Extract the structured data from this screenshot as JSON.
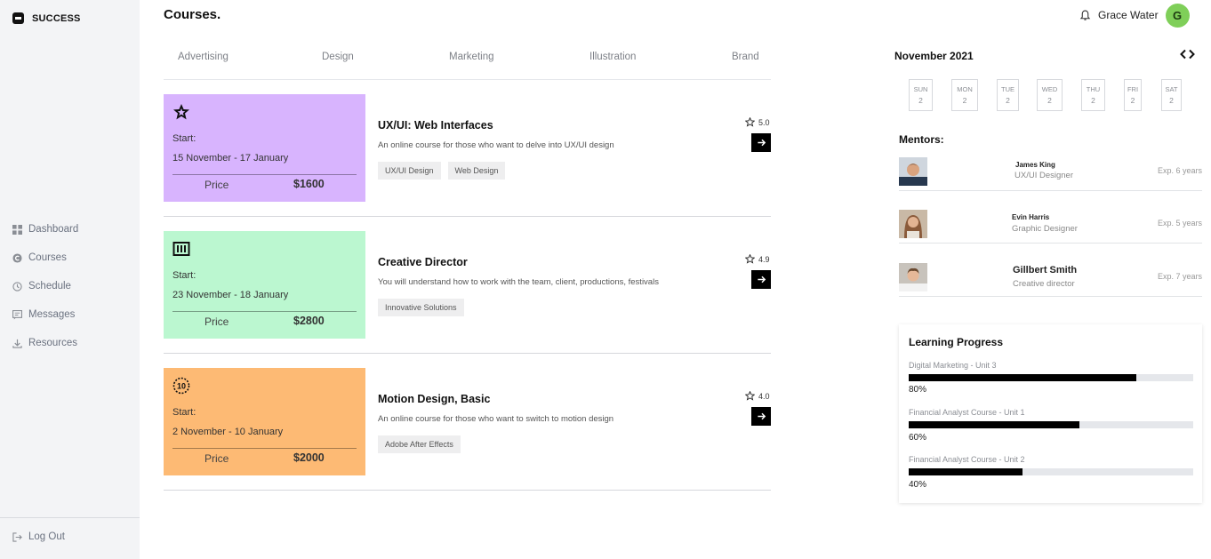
{
  "brand": {
    "name": "SUCCESS"
  },
  "nav": [
    {
      "label": "Dashboard",
      "icon": "dashboard-icon"
    },
    {
      "label": "Courses",
      "icon": "courses-icon"
    },
    {
      "label": "Schedule",
      "icon": "clock-icon"
    },
    {
      "label": "Messages",
      "icon": "message-icon"
    },
    {
      "label": "Resources",
      "icon": "download-icon"
    }
  ],
  "logout": {
    "label": "Log Out"
  },
  "page": {
    "title": "Courses."
  },
  "tabs": [
    "Advertising",
    "Design",
    "Marketing",
    "Illustration",
    "Brand"
  ],
  "courses": [
    {
      "color": "#d8b4fe",
      "icon": "star-badge-icon",
      "start_label": "Start:",
      "dates": "15 November - 17 January",
      "price_label": "Price",
      "price": "$1600",
      "title": "UX/UI: Web Interfaces",
      "description": "An online course for those who want to delve into UX/UI design",
      "tags": [
        "UX/UI Design",
        "Web Design"
      ],
      "rating": "5.0"
    },
    {
      "color": "#bbf7d0",
      "icon": "barcode-icon",
      "start_label": "Start:",
      "dates": "23 November - 18 January",
      "price_label": "Price",
      "price": "$2800",
      "title": "Creative Director",
      "description": "You will understand how to work with the team, client, productions, festivals",
      "tags": [
        "Innovative Solutions"
      ],
      "rating": "4.9"
    },
    {
      "color": "#fdba74",
      "icon": "ten-badge-icon",
      "start_label": "Start:",
      "dates": "2 November - 10 January",
      "price_label": "Price",
      "price": "$2000",
      "title": "Motion Design, Basic",
      "description": "An online course for those who want to switch to motion design",
      "tags": [
        "Adobe After Effects"
      ],
      "rating": "4.0"
    }
  ],
  "user": {
    "name": "Grace Water",
    "initial": "G"
  },
  "calendar": {
    "month": "November 2021",
    "arrows": "<>",
    "days": [
      {
        "name": "SUN",
        "date": "2"
      },
      {
        "name": "MON",
        "date": "2"
      },
      {
        "name": "TUE",
        "date": "2"
      },
      {
        "name": "WED",
        "date": "2"
      },
      {
        "name": "THU",
        "date": "2"
      },
      {
        "name": "FRI",
        "date": "2"
      },
      {
        "name": "SAT",
        "date": "2"
      }
    ]
  },
  "mentors": {
    "title": "Mentors:",
    "items": [
      {
        "name": "James King",
        "role": "UX/UI Designer",
        "exp": "Exp. 6 years"
      },
      {
        "name": "Evin Harris",
        "role": "Graphic Designer",
        "exp": "Exp. 5 years"
      },
      {
        "name": "Gillbert Smith",
        "role": "Creative director",
        "exp": "Exp. 7 years"
      }
    ]
  },
  "progress": {
    "title": "Learning Progress",
    "items": [
      {
        "label": "Digital Marketing - Unit 3",
        "value": 80,
        "value_label": "80%"
      },
      {
        "label": "Financial Analyst Course - Unit 1",
        "value": 60,
        "value_label": "60%"
      },
      {
        "label": "Financial Analyst Course - Unit 2",
        "value": 40,
        "value_label": "40%"
      }
    ]
  }
}
